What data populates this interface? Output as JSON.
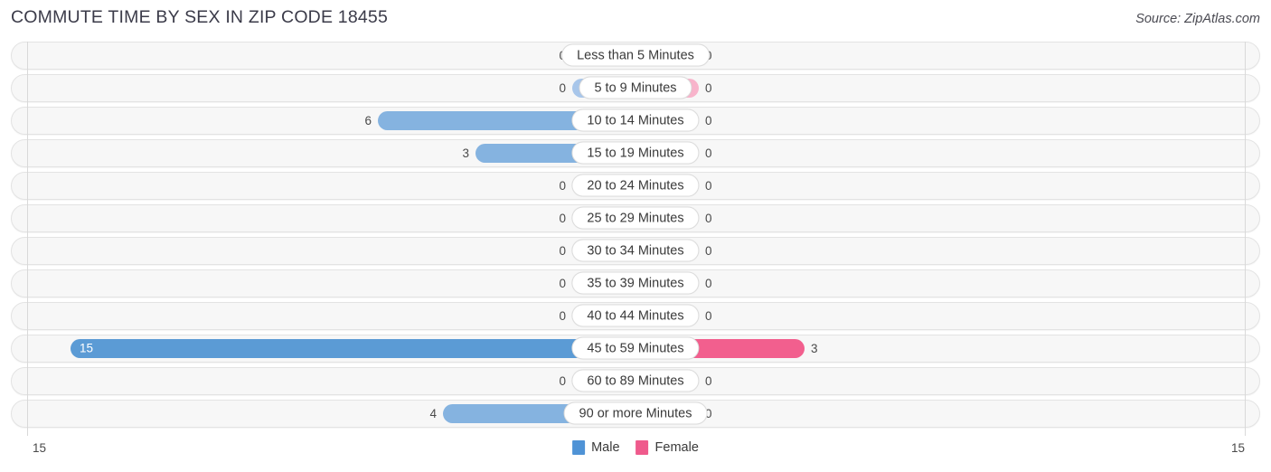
{
  "header": {
    "title": "COMMUTE TIME BY SEX IN ZIP CODE 18455",
    "source": "Source: ZipAtlas.com"
  },
  "axis": {
    "left_tick": "15",
    "right_tick": "15"
  },
  "legend": {
    "items": [
      {
        "label": "Male",
        "color": "#4f93d6",
        "icon": "square-swatch"
      },
      {
        "label": "Female",
        "color": "#ef5a8c",
        "icon": "square-swatch"
      }
    ]
  },
  "colors": {
    "male_light": "#a8c6ea",
    "male_mid": "#85b3e0",
    "male_strong": "#5b9bd5",
    "female_light": "#f8b4cb",
    "female_strong": "#f25f8e",
    "row_background": "#f7f7f7",
    "row_border": "#e3e3e3",
    "axis_line": "#d9d9d9"
  },
  "chart_data": {
    "type": "bar",
    "title": "COMMUTE TIME BY SEX IN ZIP CODE 18455",
    "orientation": "horizontal-diverging",
    "xlabel": "",
    "ylabel": "",
    "xlim": [
      15,
      15
    ],
    "grid": false,
    "legend_position": "bottom-center",
    "categories": [
      "Less than 5 Minutes",
      "5 to 9 Minutes",
      "10 to 14 Minutes",
      "15 to 19 Minutes",
      "20 to 24 Minutes",
      "25 to 29 Minutes",
      "30 to 34 Minutes",
      "35 to 39 Minutes",
      "40 to 44 Minutes",
      "45 to 59 Minutes",
      "60 to 89 Minutes",
      "90 or more Minutes"
    ],
    "series": [
      {
        "name": "Male",
        "values": [
          0,
          0,
          6,
          3,
          0,
          0,
          0,
          0,
          0,
          15,
          0,
          4
        ]
      },
      {
        "name": "Female",
        "values": [
          0,
          0,
          0,
          0,
          0,
          0,
          0,
          0,
          0,
          3,
          0,
          0
        ]
      }
    ]
  },
  "rows": [
    {
      "label": "Less than 5 Minutes",
      "male": "0",
      "female": "0",
      "male_w": 70,
      "female_w": 70,
      "male_tone": "light",
      "female_tone": "light",
      "male_inside": false
    },
    {
      "label": "5 to 9 Minutes",
      "male": "0",
      "female": "0",
      "male_w": 70,
      "female_w": 70,
      "male_tone": "light",
      "female_tone": "light",
      "male_inside": false
    },
    {
      "label": "10 to 14 Minutes",
      "male": "6",
      "female": "0",
      "male_w": 285,
      "female_w": 70,
      "male_tone": "mid",
      "female_tone": "light",
      "male_inside": false
    },
    {
      "label": "15 to 19 Minutes",
      "male": "3",
      "female": "0",
      "male_w": 177,
      "female_w": 70,
      "male_tone": "mid",
      "female_tone": "light",
      "male_inside": false
    },
    {
      "label": "20 to 24 Minutes",
      "male": "0",
      "female": "0",
      "male_w": 70,
      "female_w": 70,
      "male_tone": "light",
      "female_tone": "light",
      "male_inside": false
    },
    {
      "label": "25 to 29 Minutes",
      "male": "0",
      "female": "0",
      "male_w": 70,
      "female_w": 70,
      "male_tone": "light",
      "female_tone": "light",
      "male_inside": false
    },
    {
      "label": "30 to 34 Minutes",
      "male": "0",
      "female": "0",
      "male_w": 70,
      "female_w": 70,
      "male_tone": "light",
      "female_tone": "light",
      "male_inside": false
    },
    {
      "label": "35 to 39 Minutes",
      "male": "0",
      "female": "0",
      "male_w": 70,
      "female_w": 70,
      "male_tone": "light",
      "female_tone": "light",
      "male_inside": false
    },
    {
      "label": "40 to 44 Minutes",
      "male": "0",
      "female": "0",
      "male_w": 70,
      "female_w": 70,
      "male_tone": "light",
      "female_tone": "light",
      "male_inside": false
    },
    {
      "label": "45 to 59 Minutes",
      "male": "15",
      "female": "3",
      "male_w": 625,
      "female_w": 187,
      "male_tone": "hi",
      "female_tone": "hi",
      "male_inside": true
    },
    {
      "label": "60 to 89 Minutes",
      "male": "0",
      "female": "0",
      "male_w": 70,
      "female_w": 70,
      "male_tone": "light",
      "female_tone": "light",
      "male_inside": false
    },
    {
      "label": "90 or more Minutes",
      "male": "4",
      "female": "0",
      "male_w": 213,
      "female_w": 70,
      "male_tone": "mid",
      "female_tone": "light",
      "male_inside": false
    }
  ]
}
